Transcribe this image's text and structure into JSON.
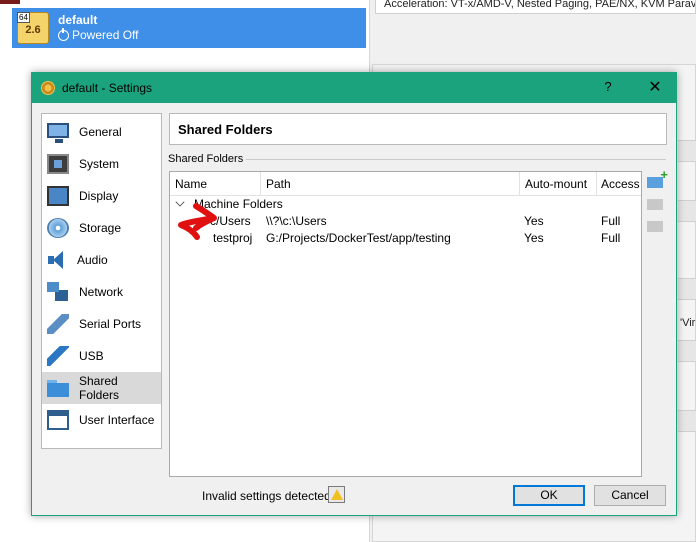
{
  "manager": {
    "vm": {
      "badge": "64",
      "version": "2.6",
      "name": "default",
      "state": "Powered Off"
    },
    "acceleration_text": "Acceleration:     VT-x/AMD-V, Nested Paging, PAE/NX, KVM Paravi",
    "partial_text": "'Vir"
  },
  "dialog": {
    "title": "default - Settings",
    "help_label": "?",
    "close_label": "✕",
    "nav": [
      {
        "label": "General",
        "icon": "general-icon"
      },
      {
        "label": "System",
        "icon": "system-icon"
      },
      {
        "label": "Display",
        "icon": "display-icon"
      },
      {
        "label": "Storage",
        "icon": "storage-icon"
      },
      {
        "label": "Audio",
        "icon": "audio-icon"
      },
      {
        "label": "Network",
        "icon": "network-icon"
      },
      {
        "label": "Serial Ports",
        "icon": "serial-ports-icon"
      },
      {
        "label": "USB",
        "icon": "usb-icon"
      },
      {
        "label": "Shared Folders",
        "icon": "shared-folders-icon",
        "selected": true
      },
      {
        "label": "User Interface",
        "icon": "user-interface-icon"
      }
    ],
    "page_title": "Shared Folders",
    "group_label": "Shared Folders",
    "table": {
      "columns": [
        "Name",
        "Path",
        "Auto-mount",
        "Access"
      ],
      "group": "Machine Folders",
      "rows": [
        {
          "name": "c/Users",
          "path": "\\\\?\\c:\\Users",
          "automount": "Yes",
          "access": "Full"
        },
        {
          "name": "testproj",
          "path": "G:/Projects/DockerTest/app/testing",
          "automount": "Yes",
          "access": "Full"
        }
      ]
    },
    "status": "Invalid settings detected",
    "ok_label": "OK",
    "cancel_label": "Cancel"
  },
  "colors": {
    "title_bar": "#1aa37d",
    "selection": "#3f8ee8",
    "annotation": "#e01010"
  }
}
